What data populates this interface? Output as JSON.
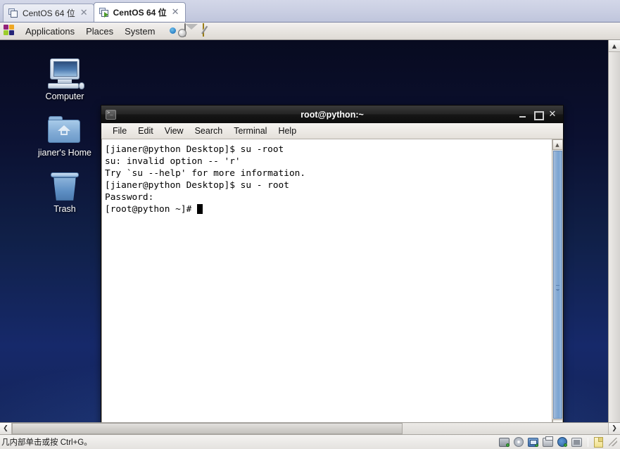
{
  "vmware": {
    "tabs": [
      {
        "label": "CentOS 64 位",
        "active": false,
        "close_glyph": "✕"
      },
      {
        "label": "CentOS 64 位",
        "active": true,
        "close_glyph": "✕"
      }
    ],
    "status_text": "几内部单击或按 Ctrl+G。",
    "status_icons": [
      "harddisk-icon",
      "cdrom-icon",
      "network-icon",
      "printer-icon",
      "sound-icon",
      "usb-icon",
      "document-icon"
    ],
    "hscroll": {
      "left_arrow": "❮",
      "right_arrow": "❯"
    },
    "vscroll": {
      "up_arrow": "▲"
    }
  },
  "gnome_panel": {
    "menus": [
      "Applications",
      "Places",
      "System"
    ],
    "launchers": [
      "firefox-icon",
      "evolution-mail-icon",
      "text-editor-icon"
    ]
  },
  "desktop": {
    "icons": [
      {
        "label": "Computer",
        "icon": "computer-icon"
      },
      {
        "label": "jianer's Home",
        "icon": "home-folder-icon"
      },
      {
        "label": "Trash",
        "icon": "trash-icon"
      }
    ]
  },
  "terminal": {
    "title": "root@python:~",
    "app_icon": "terminal-icon",
    "window_buttons": {
      "minimize": "minimize-icon",
      "maximize": "maximize-icon",
      "close": "✕"
    },
    "menus": [
      "File",
      "Edit",
      "View",
      "Search",
      "Terminal",
      "Help"
    ],
    "lines": [
      "[jianer@python Desktop]$ su -root",
      "su: invalid option -- 'r'",
      "Try `su --help' for more information.",
      "[jianer@python Desktop]$ su - root",
      "Password:",
      "[root@python ~]# "
    ],
    "scrollbar": {
      "up_arrow": "▲",
      "down_arrow": "▼"
    }
  },
  "colors": {
    "desktop_blue": "#102048",
    "titlebar_black": "#1a1a1a",
    "terminal_bg": "#ffffff",
    "terminal_fg": "#000000",
    "scrollbar_blue": "#7ba4d2"
  }
}
